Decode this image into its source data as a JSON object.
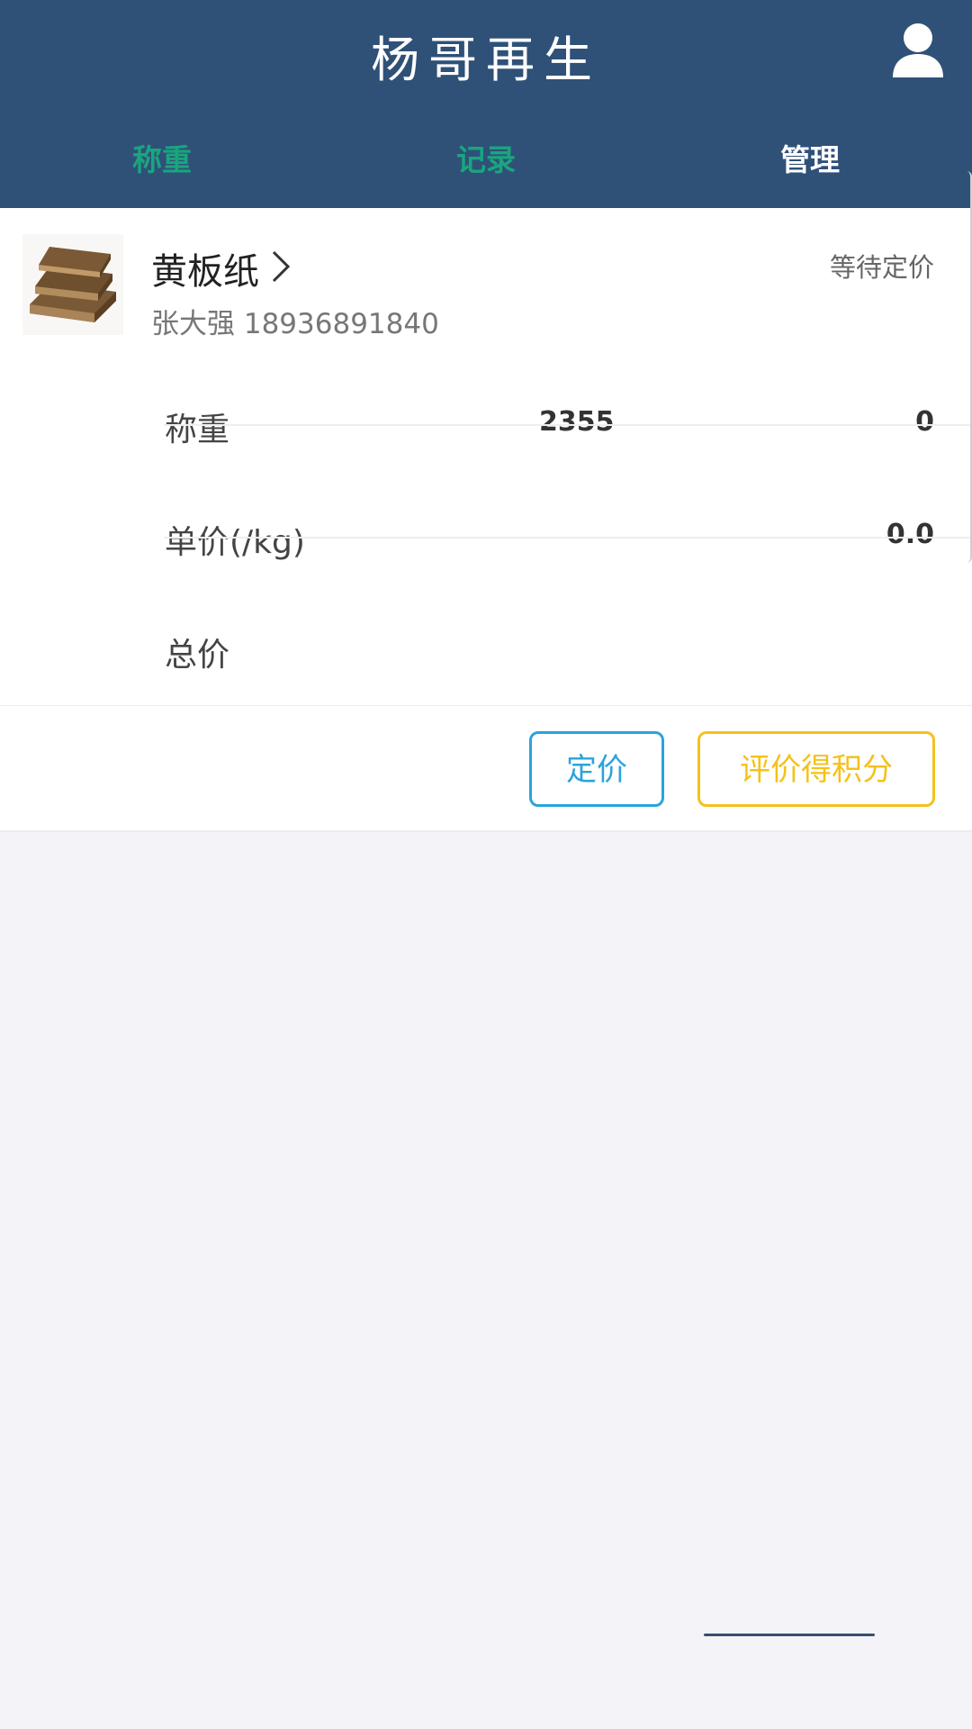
{
  "header": {
    "title": "杨哥再生",
    "user_icon": "user-icon"
  },
  "tabs": [
    {
      "label": "称重",
      "active": false
    },
    {
      "label": "记录",
      "active": false
    },
    {
      "label": "管理",
      "active": true
    }
  ],
  "order": {
    "item_name": "黄板纸",
    "status": "等待定价",
    "customer": "张大强 18936891840",
    "rows": [
      {
        "label": "称重",
        "value_mid": "2355",
        "value_right": "0"
      },
      {
        "label": "单价(/kg)",
        "value_right": "0.0"
      },
      {
        "label": "总价"
      }
    ]
  },
  "actions": {
    "price_label": "定价",
    "rate_label": "评价得积分"
  },
  "colors": {
    "header_bg": "#2f5178",
    "tab_inactive": "#1aa57e",
    "btn_price": "#2ba3dc",
    "btn_rate": "#f5c11b"
  }
}
